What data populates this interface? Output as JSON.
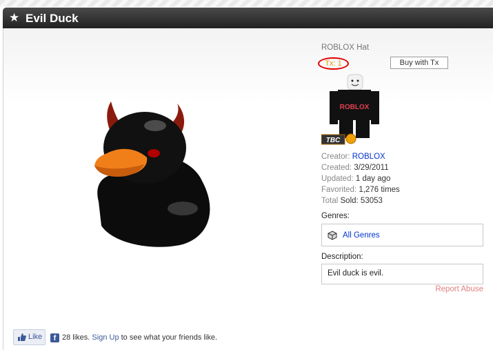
{
  "item": {
    "title": "Evil Duck",
    "type": "ROBLOX Hat",
    "price": "Tx: 1",
    "buy_button": "Buy with Tx"
  },
  "avatar": {
    "shirt_text": "ROBLOX",
    "badge": "TBC"
  },
  "details": {
    "creator_label": "Creator:",
    "creator": "ROBLOX",
    "created_label": "Created:",
    "created": "3/29/2011",
    "updated_label": "Updated:",
    "updated": "1 day ago",
    "favorited_label": "Favorited:",
    "favorited": "1,276 times",
    "sold_label_a": "Total",
    "sold_label_b": "Sold:",
    "sold": "53053"
  },
  "genres": {
    "label": "Genres:",
    "value": "All Genres",
    "icon": "cube-icon"
  },
  "description": {
    "label": "Description:",
    "text": "Evil duck is evil."
  },
  "report": "Report Abuse",
  "facebook": {
    "like_button": "Like",
    "fb_icon": "f",
    "likes_text": "28 likes.",
    "signup": "Sign Up",
    "suffix": "to see what your friends like."
  },
  "colors": {
    "title_bar": "#333333",
    "price": "#e3a000",
    "link": "#0033cc",
    "report": "#e08080",
    "highlight_circle": "#e00000"
  }
}
